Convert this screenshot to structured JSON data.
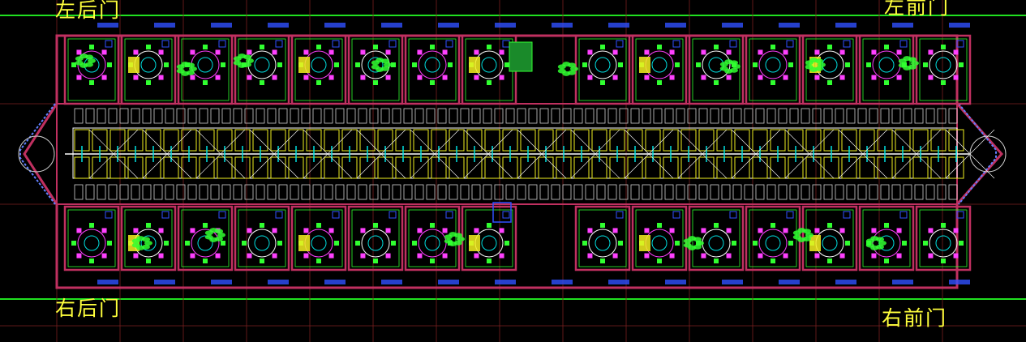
{
  "labels": {
    "left_rear_door": "左后门",
    "left_front_door": "左前门",
    "right_rear_door": "右后门",
    "right_front_door": "右前门"
  },
  "colors": {
    "background": "#000000",
    "boundary_line": "#20e020",
    "wall": "#c03060",
    "label": "#ffff3c",
    "cyan": "#00e0e0",
    "magenta": "#ff40ff",
    "green": "#30ff30",
    "white": "#ffffff",
    "red": "#ff2020",
    "blue": "#3050ff"
  },
  "icons": [
    "round-table-icon",
    "plant-icon",
    "fan-icon"
  ]
}
